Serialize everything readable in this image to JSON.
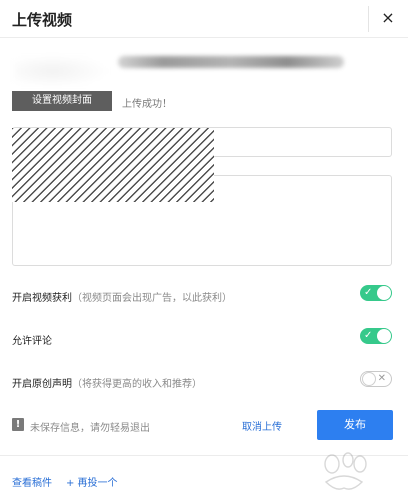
{
  "dialog": {
    "title": "上传视频",
    "close_icon": "×"
  },
  "upload": {
    "set_cover_label": "设置视频封面",
    "status_text": "上传成功！"
  },
  "form": {
    "title_value": "",
    "description_value": ""
  },
  "options": [
    {
      "label": "开启视频获利",
      "hint": "（视频页面会出现广告，以此获利）",
      "enabled": true
    },
    {
      "label": "允许评论",
      "hint": "",
      "enabled": true
    },
    {
      "label": "开启原创声明",
      "hint": "（将获得更高的收入和推荐）",
      "enabled": false
    }
  ],
  "toggle_marks": {
    "on": "✓",
    "off": "✕"
  },
  "footer": {
    "warning_icon": "!",
    "warning_text": "未保存信息，请勿轻易退出",
    "cancel_upload_label": "取消上传",
    "publish_label": "发布",
    "view_drafts_label": "查看稿件",
    "post_another_label": "+ 再投一个"
  },
  "colors": {
    "accent": "#2d7ff0",
    "toggle_on": "#36c98b",
    "link": "#2a6fd6"
  },
  "icons": {
    "close": "close-icon",
    "warning": "warning-icon",
    "check": "check-icon",
    "cross": "cross-icon"
  }
}
